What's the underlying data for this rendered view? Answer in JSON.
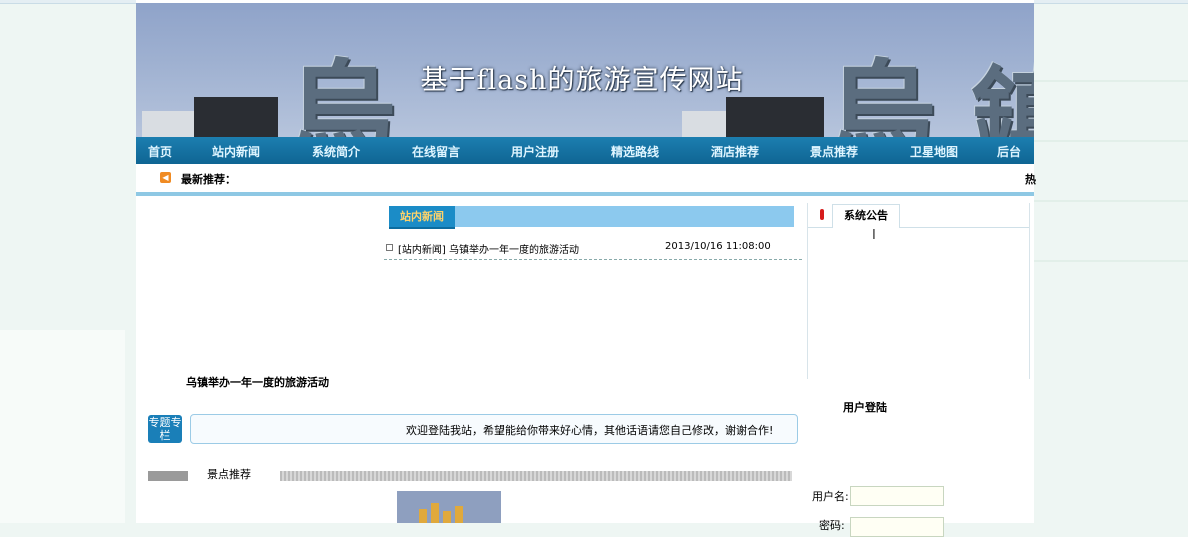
{
  "banner": {
    "title": "基于flash的旅游宣传网站"
  },
  "nav": {
    "items": [
      "首页",
      "站内新闻",
      "系统简介",
      "在线留言",
      "用户注册",
      "精选路线",
      "酒店推荐",
      "景点推荐",
      "卫星地图",
      "后台"
    ]
  },
  "latest": {
    "label": "最新推荐：",
    "hot_prefix": "热"
  },
  "news": {
    "tab": "站内新闻",
    "items": [
      {
        "title": "[站内新闻] 乌镇举办一年一度的旅游活动",
        "date": "2013/10/16 11:08:00"
      }
    ]
  },
  "featured": {
    "title": "乌镇举办一年一度的旅游活动"
  },
  "special": {
    "icon_text": "专题专栏",
    "message": "欢迎登陆我站，希望能给你带来好心情，其他话语请您自己修改，谢谢合作!"
  },
  "scenic": {
    "label": "景点推荐"
  },
  "notice": {
    "title": "系统公告"
  },
  "login": {
    "title": "用户登陆",
    "username_label": "用户名:",
    "password_label": "密码:",
    "username_value": "",
    "password_value": ""
  },
  "colors": {
    "nav_bg": "#0f6593",
    "accent": "#8cc9ee",
    "tab": "#1b8cc7"
  }
}
